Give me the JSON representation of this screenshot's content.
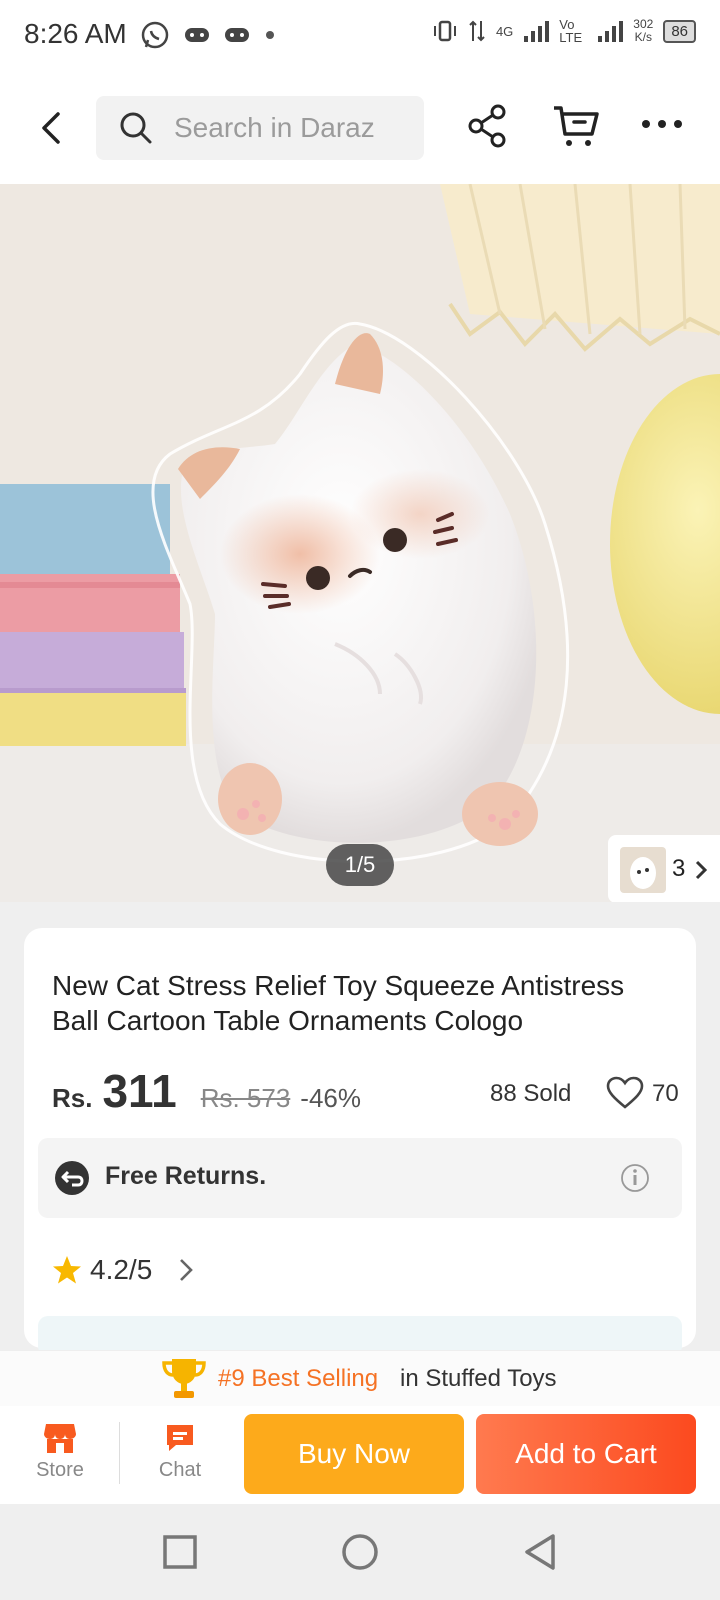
{
  "status_bar": {
    "time": "8:26 AM",
    "speed_value": "302",
    "speed_unit": "K/s",
    "network": "4G",
    "volte": "Vo LTE",
    "battery": "86"
  },
  "topbar": {
    "search_placeholder": "Search in Daraz"
  },
  "gallery": {
    "pager": "1/5",
    "variant_count": "3"
  },
  "product": {
    "title": "New Cat Stress Relief  Toy Squeeze Antistress Ball Cartoon Table Ornaments Cologo",
    "currency": "Rs.",
    "price": "311",
    "original_price": "Rs. 573",
    "discount": "-46%",
    "sold": "88 Sold",
    "wishlist_count": "70",
    "returns": "Free Returns.",
    "rating": "4.2/5"
  },
  "best_selling": {
    "rank": "#9 Best Selling",
    "category": "in Stuffed Toys"
  },
  "actions": {
    "store": "Store",
    "chat": "Chat",
    "buy_now": "Buy Now",
    "add_to_cart": "Add to Cart"
  },
  "colors": {
    "brand_orange": "#fc4a1f",
    "buy_now": "#fdaa1b",
    "accent_text": "#f57224"
  }
}
